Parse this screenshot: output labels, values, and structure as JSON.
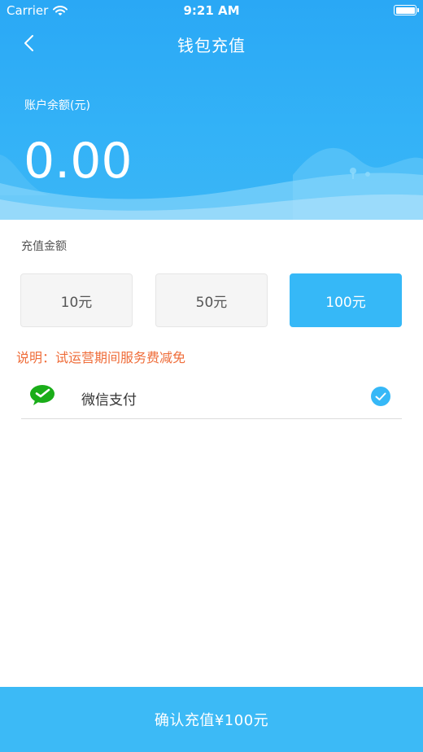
{
  "status_bar": {
    "carrier": "Carrier",
    "time": "9:21 AM"
  },
  "nav": {
    "title": "钱包充值",
    "back_icon": "chevron-left-icon"
  },
  "balance": {
    "label": "账户余额(元)",
    "value": "0.00"
  },
  "recharge": {
    "section_label": "充值金额",
    "options": [
      {
        "label": "10元",
        "selected": false
      },
      {
        "label": "50元",
        "selected": false
      },
      {
        "label": "100元",
        "selected": true
      }
    ]
  },
  "note": "说明：试运营期间服务费减免",
  "payment": {
    "method_label": "微信支付",
    "icon": "wechat-icon",
    "selected": true
  },
  "confirm": {
    "label": "确认充值¥100元"
  },
  "colors": {
    "primary": "#36b8f7",
    "header_top": "#2aa8f5",
    "note": "#ef6d3a",
    "wechat_green": "#1aad19"
  }
}
